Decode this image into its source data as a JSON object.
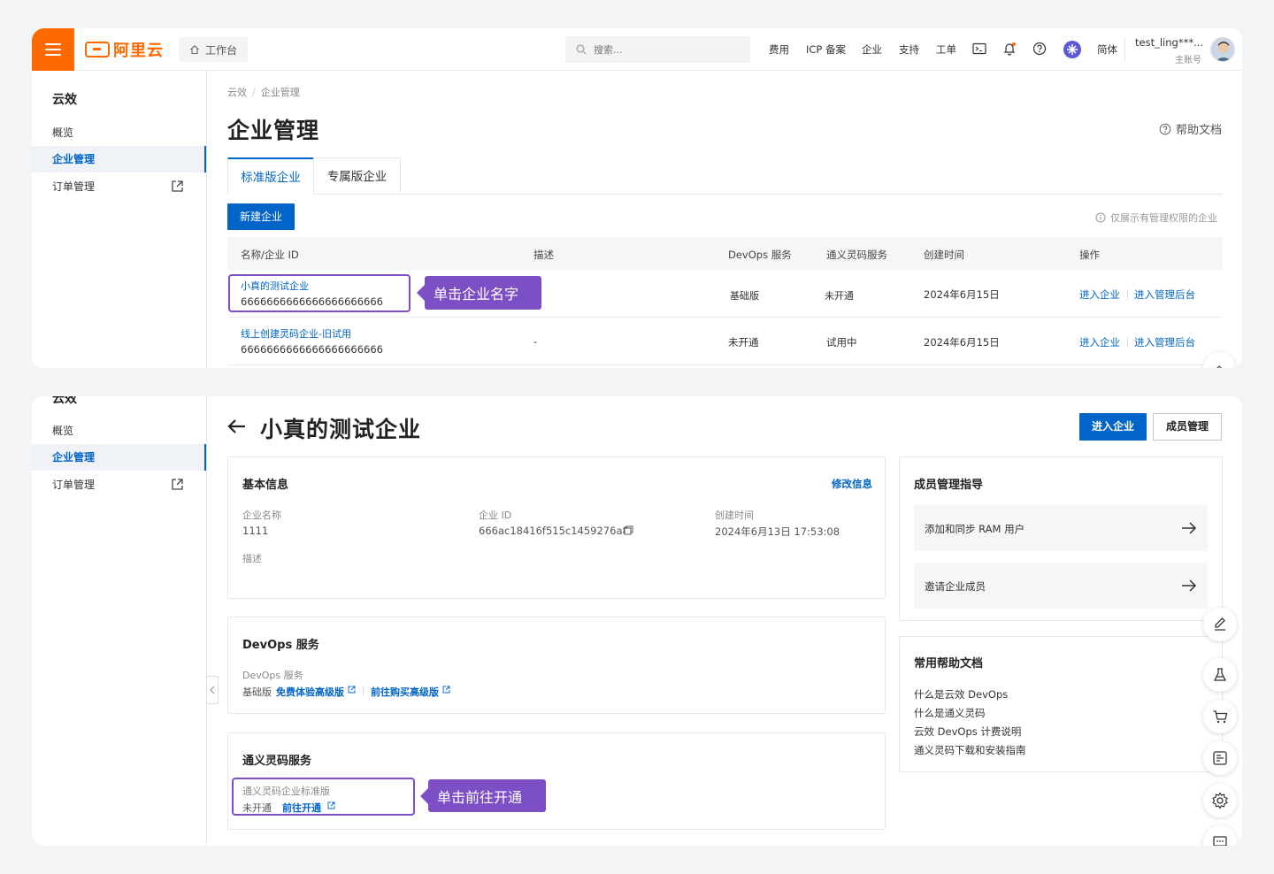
{
  "topbar": {
    "brand": "阿里云",
    "workbench": "工作台",
    "search_placeholder": "搜索...",
    "nav": [
      "费用",
      "ICP 备案",
      "企业",
      "支持",
      "工单"
    ],
    "lang": "简体",
    "user_name": "test_ling***...",
    "user_role": "主账号",
    "icons": [
      "menu-icon",
      "home-icon",
      "search-icon",
      "terminal-icon",
      "bell-icon",
      "help-icon",
      "ai-assistant-icon"
    ],
    "accent": "#ff6a00"
  },
  "sidebar": {
    "title": "云效",
    "items": [
      {
        "label": "概览"
      },
      {
        "label": "企业管理",
        "active": true
      },
      {
        "label": "订单管理"
      }
    ]
  },
  "page1": {
    "breadcrumb": [
      "云效",
      "企业管理"
    ],
    "title": "企业管理",
    "help_doc": "帮助文档",
    "tabs": [
      "标准版企业",
      "专属版企业"
    ],
    "new_button": "新建企业",
    "note": "仅展示有管理权限的企业",
    "columns": [
      "名称/企业 ID",
      "描述",
      "DevOps 服务",
      "通义灵码服务",
      "创建时间",
      "操作"
    ],
    "rows": [
      {
        "name": "小真的测试企业",
        "id": "6666666666666666666666",
        "desc": "",
        "devops": "基础版",
        "lingma": "未开通",
        "created": "2024年6月15日",
        "ops": [
          "进入企业",
          "进入管理后台"
        ]
      },
      {
        "name": "线上创建灵码企业-旧试用",
        "id": "6666666666666666666666",
        "desc": "-",
        "devops": "未开通",
        "lingma": "试用中",
        "created": "2024年6月15日",
        "ops": [
          "进入企业",
          "进入管理后台"
        ]
      }
    ],
    "callout": "单击企业名字"
  },
  "page2": {
    "title": "小真的测试企业",
    "btn_enter": "进入企业",
    "btn_members": "成员管理",
    "basic": {
      "title": "基本信息",
      "edit": "修改信息",
      "name_label": "企业名称",
      "name_value": "1111",
      "id_label": "企业 ID",
      "id_value": "666ac18416f515c1459276a8",
      "created_label": "创建时间",
      "created_value": "2024年6月13日 17:53:08",
      "desc_label": "描述"
    },
    "devops": {
      "title": "DevOps 服务",
      "label": "DevOps 服务",
      "tier": "基础版",
      "trial_link": "免费体验高级版",
      "buy_link": "前往购买高级版"
    },
    "lingma": {
      "title": "通义灵码服务",
      "label": "通义灵码企业标准版",
      "status": "未开通",
      "open_link": "前往开通"
    },
    "guide": {
      "title": "成员管理指导",
      "items": [
        "添加和同步 RAM 用户",
        "邀请企业成员"
      ]
    },
    "docs": {
      "title": "常用帮助文档",
      "items": [
        "什么是云效 DevOps",
        "什么是通义灵码",
        "云效 DevOps 计费说明",
        "通义灵码下载和安装指南"
      ]
    },
    "callout": "单击前往开通",
    "float_icons": [
      "edit-icon",
      "flask-icon",
      "cart-icon",
      "feedback-icon",
      "settings-icon",
      "chat-icon"
    ]
  },
  "colors": {
    "primary": "#0064c8",
    "highlight": "#7c4fc4",
    "orange": "#ff6a00"
  }
}
